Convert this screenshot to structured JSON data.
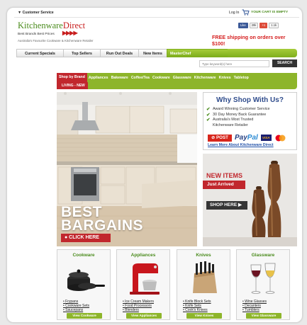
{
  "topbar": {
    "customer_service": "▼ Customer Service",
    "login": "Log In",
    "cart": "YOUR CART IS EMPTY"
  },
  "brand": {
    "name_part1": "Kitchenware",
    "name_part2": "Direct",
    "slogan": "Best Brands Best Prices",
    "tagline": "Australia's Favourite Cookware & Kitchenware Retailer"
  },
  "social": {
    "like": "Like",
    "like_count": "29k",
    "plus": "+1",
    "plus_count": "1.1k"
  },
  "promo": {
    "free_shipping": "FREE shipping on orders over $100!"
  },
  "nav": {
    "tabs": [
      "Current Specials",
      "Top Sellers",
      "Run Out Deals",
      "New Items",
      "MasterChef"
    ]
  },
  "search": {
    "placeholder": "Type keyword(s) here",
    "button": "SEARCH"
  },
  "categories": {
    "items": [
      "Shop by Brand",
      "Appliances",
      "Bakeware",
      "Coffee/Tea",
      "Cookware",
      "Glassware",
      "Kitchenware",
      "Knives",
      "Tabletop"
    ],
    "living": "LIVING - NEW"
  },
  "hero": {
    "line1": "BEST",
    "line2": "BARGAINS",
    "cta": "● CLICK HERE"
  },
  "why": {
    "title": "Why Shop With Us?",
    "points": [
      "Award Winning Customer Service",
      "30 Day Money Back Guarantee",
      "Australia's Most Trusted",
      "Kitchenware Retailer"
    ],
    "auspost": "POST",
    "paypal_a": "Pay",
    "paypal_b": "Pal",
    "visa": "VISA",
    "learn_more": "Learn More About Kitchenware Direct"
  },
  "new_items": {
    "title": "NEW ITEMS",
    "subtitle": "Just Arrived",
    "cta": "SHOP HERE ▶"
  },
  "products": [
    {
      "title": "Cookware",
      "links": [
        "Frypans",
        "Cookware Sets",
        "Saucepans"
      ],
      "button": "View Cookware"
    },
    {
      "title": "Appliances",
      "links": [
        "Ice Cream Makers",
        "Food Processors",
        "Blenders"
      ],
      "button": "View Appliances"
    },
    {
      "title": "Knives",
      "links": [
        "Knife Block Sets",
        "Knife Sets",
        "Cook's Knives"
      ],
      "button": "View Knives"
    },
    {
      "title": "Glassware",
      "links": [
        "Wine Glasses",
        "Decanters",
        "Tumblers"
      ],
      "button": "View Glassware"
    }
  ],
  "colors": {
    "brand_green": "#8db52a",
    "brand_red": "#c1272d",
    "why_blue": "#2f4c8c"
  }
}
